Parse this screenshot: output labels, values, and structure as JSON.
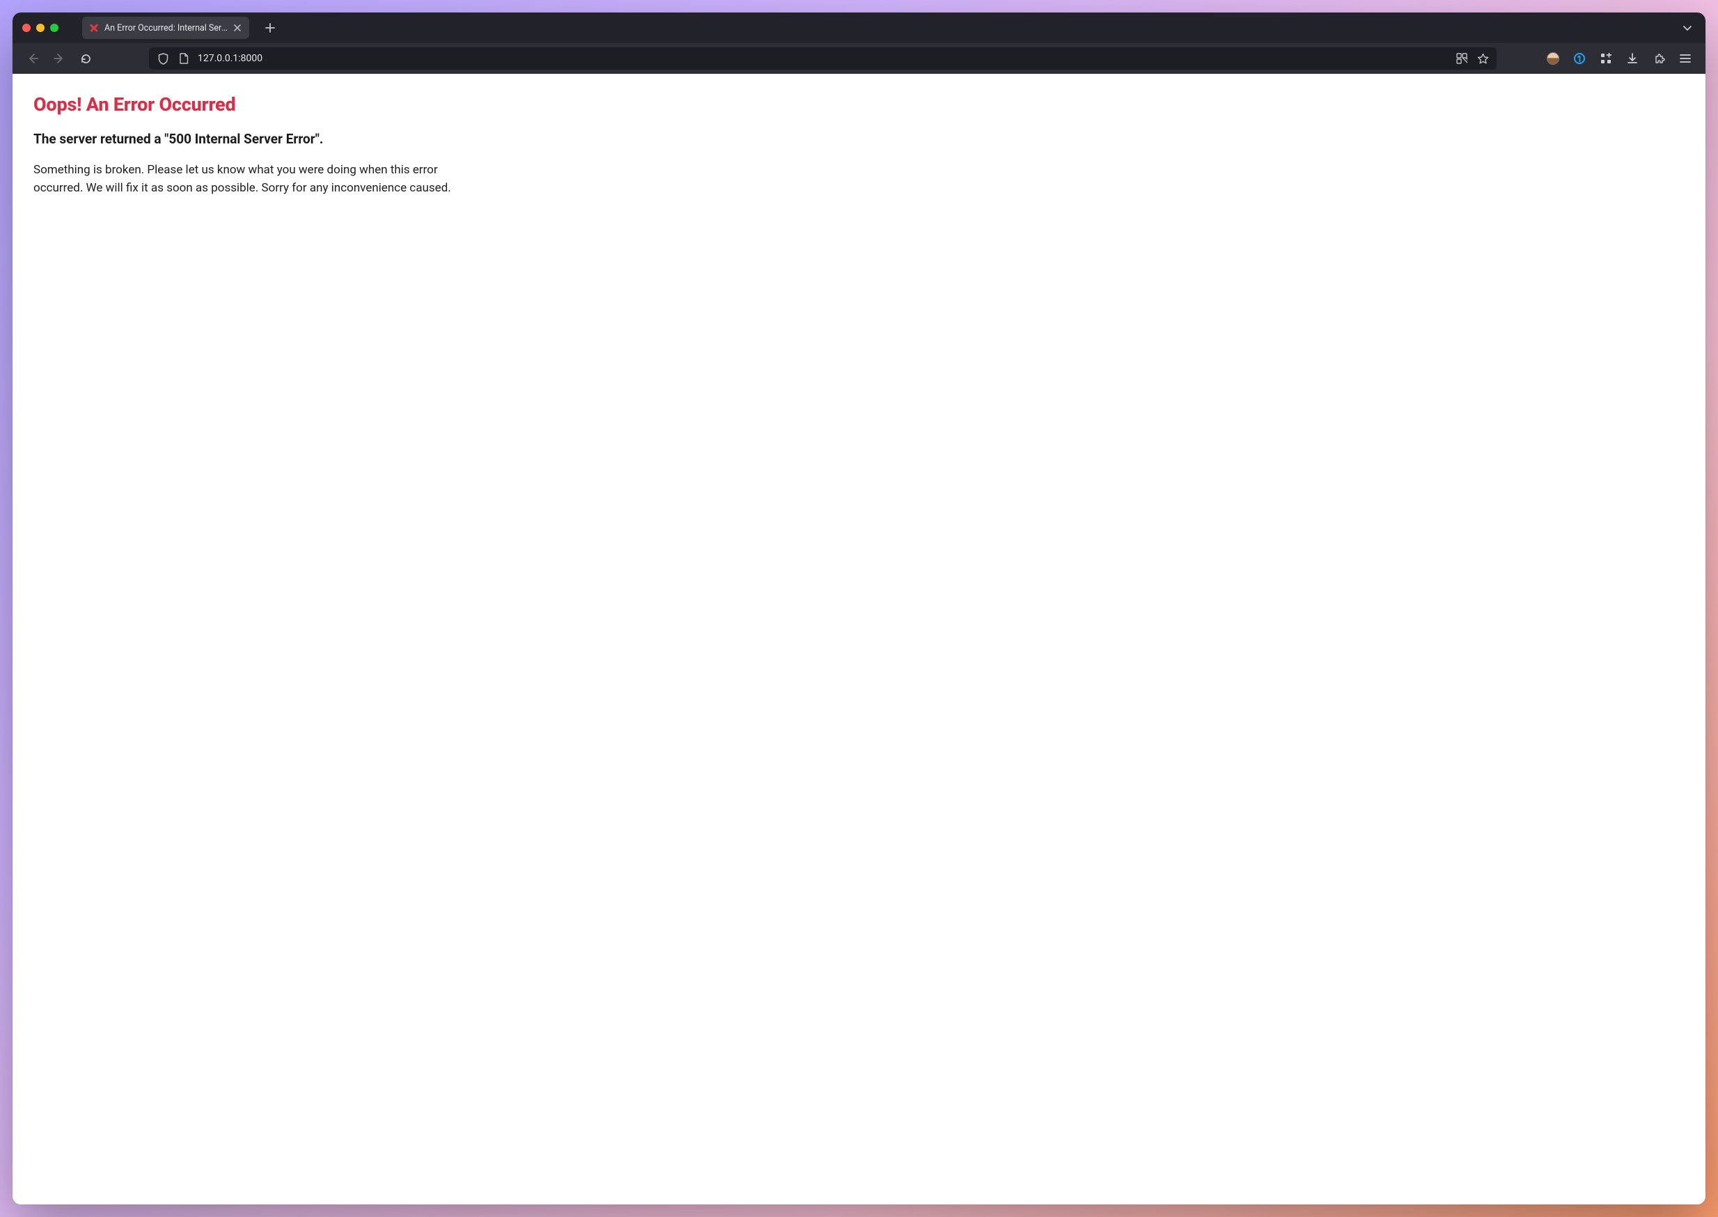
{
  "window": {
    "tab": {
      "title": "An Error Occurred: Internal Server Error",
      "favicon": "error-x-icon"
    },
    "overflow_icon": "chevron-down-icon"
  },
  "toolbar": {
    "url": "127.0.0.1:8000",
    "icons": {
      "shield": "shield-icon",
      "page": "page-icon",
      "container": "container-tabs-icon",
      "bookmark": "star-icon",
      "profile": "profile-avatar-icon",
      "onepassword": "onepassword-icon",
      "apps": "apps-grid-icon",
      "downloads": "download-icon",
      "extensions": "puzzle-icon",
      "menu": "hamburger-icon"
    }
  },
  "page": {
    "heading": "Oops! An Error Occurred",
    "subheading": "The server returned a \"500 Internal Server Error\".",
    "body": "Something is broken. Please let us know what you were doing when this error occurred. We will fix it as soon as possible. Sorry for any inconvenience caused."
  },
  "colors": {
    "error_heading": "#d6314b",
    "chrome_dark": "#2c2d35",
    "tabbar_dark": "#22232a"
  }
}
